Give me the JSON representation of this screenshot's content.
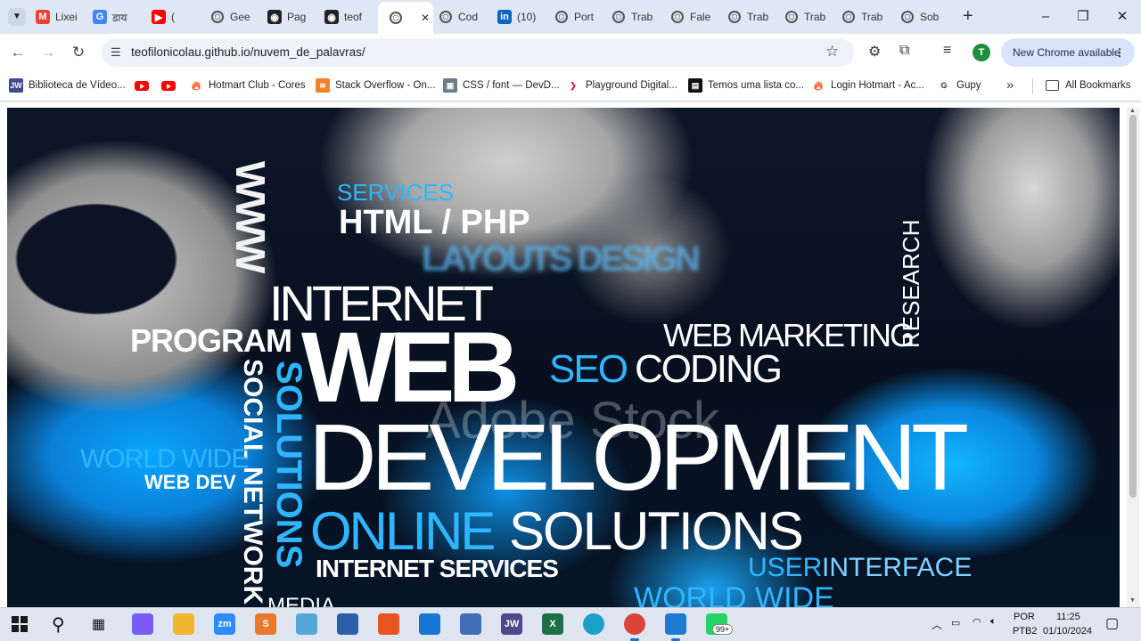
{
  "browser": {
    "tabs": [
      {
        "label": "Lixei",
        "icon": "gmail-icon"
      },
      {
        "label": "डाय",
        "icon": "google-icon"
      },
      {
        "label": "(",
        "icon": "youtube-icon"
      },
      {
        "label": "Gee",
        "icon": "globe-icon"
      },
      {
        "label": "Pag",
        "icon": "github-icon"
      },
      {
        "label": "teof",
        "icon": "github-icon"
      },
      {
        "label": "",
        "icon": "globe-icon",
        "active": true
      },
      {
        "label": "Cod",
        "icon": "globe-icon"
      },
      {
        "label": "(10)",
        "icon": "linkedin-icon"
      },
      {
        "label": "Port",
        "icon": "globe-icon"
      },
      {
        "label": "Trab",
        "icon": "globe-icon"
      },
      {
        "label": "Fale",
        "icon": "globe-icon"
      },
      {
        "label": "Trab",
        "icon": "globe-icon"
      },
      {
        "label": "Trab",
        "icon": "globe-icon"
      },
      {
        "label": "Trab",
        "icon": "globe-icon"
      },
      {
        "label": "Sob",
        "icon": "globe-icon"
      }
    ],
    "new_tab_label": "+",
    "url": "teofilonicolau.github.io/nuvem_de_palavras/",
    "avatar_letter": "T",
    "update_button": "New Chrome available",
    "update_menu": "⋮",
    "bookmarks": [
      {
        "label": "Biblioteca de Vídeo...",
        "icon": "jw-icon"
      },
      {
        "label": "",
        "icon": "youtube-icon"
      },
      {
        "label": "",
        "icon": "youtube-icon"
      },
      {
        "label": "Hotmart Club - Cores",
        "icon": "hotmart-icon"
      },
      {
        "label": "Stack Overflow - On...",
        "icon": "stackoverflow-icon"
      },
      {
        "label": "CSS / font — DevD...",
        "icon": "devdocs-icon"
      },
      {
        "label": "Playground Digital...",
        "icon": "playground-icon"
      },
      {
        "label": "Temos uma lista co...",
        "icon": "list-icon"
      },
      {
        "label": "Login Hotmart - Ac...",
        "icon": "hotmart-icon"
      },
      {
        "label": "Gupy",
        "icon": "gupy-icon"
      }
    ],
    "bookmarks_more": "»",
    "all_bookmarks": "All Bookmarks"
  },
  "page": {
    "words": {
      "www": "WWW",
      "services": "SERVICES",
      "html_php": "HTML / PHP",
      "layouts_design": "LAYOUTS DESIGN",
      "research": "RESEARCH",
      "internet": "INTERNET",
      "program": "PROGRAM",
      "web": "WEB",
      "web_marketing": "WEB MARKETING",
      "seo": "SEO",
      "coding": "CODING",
      "social_network": "SOCIAL NETWORK",
      "solutions_vertical": "SOLUTIONS",
      "world_wide": "WORLD WIDE",
      "web_dev": "WEB DEV",
      "development": "DEVELOPMENT",
      "online": "ONLINE",
      "solutions": "SOLUTIONS",
      "internet_services": "INTERNET SERVICES",
      "user": "USER",
      "interface": "INTERFACE",
      "world_wide_bottom": "WORLD WIDE",
      "media": "MEDIA"
    },
    "watermark": "Adobe Stock"
  },
  "taskbar": {
    "apps": [
      {
        "name": "copilot-icon",
        "color": "#7b5cf5",
        "text": ""
      },
      {
        "name": "file-explorer-icon",
        "color": "#f2b530",
        "text": ""
      },
      {
        "name": "zoom-icon",
        "color": "#2d8cff",
        "text": "zm"
      },
      {
        "name": "sublime-icon",
        "color": "#e9782b",
        "text": "S"
      },
      {
        "name": "notepad-icon",
        "color": "#56a7d8",
        "text": ""
      },
      {
        "name": "snipping-icon",
        "color": "#2c5fa8",
        "text": ""
      },
      {
        "name": "ubuntu-icon",
        "color": "#e95420",
        "text": ""
      },
      {
        "name": "mail-icon",
        "color": "#1676d2",
        "text": ""
      },
      {
        "name": "virtualbox-icon",
        "color": "#3f6fb6",
        "text": ""
      },
      {
        "name": "jw-library-icon",
        "color": "#4a4a8c",
        "text": "JW"
      },
      {
        "name": "excel-icon",
        "color": "#1d7044",
        "text": "X"
      },
      {
        "name": "edge-icon",
        "color": "#1aa0c8",
        "text": ""
      },
      {
        "name": "chrome-icon",
        "color": "#db4437",
        "text": ""
      },
      {
        "name": "vscode-icon",
        "color": "#1f7ad2",
        "text": ""
      },
      {
        "name": "whatsapp-icon",
        "color": "#25d366",
        "text": ""
      }
    ],
    "whatsapp_badge": "99+",
    "language": "POR",
    "layout": "PTB2",
    "time": "11:25",
    "date": "01/10/2024"
  }
}
